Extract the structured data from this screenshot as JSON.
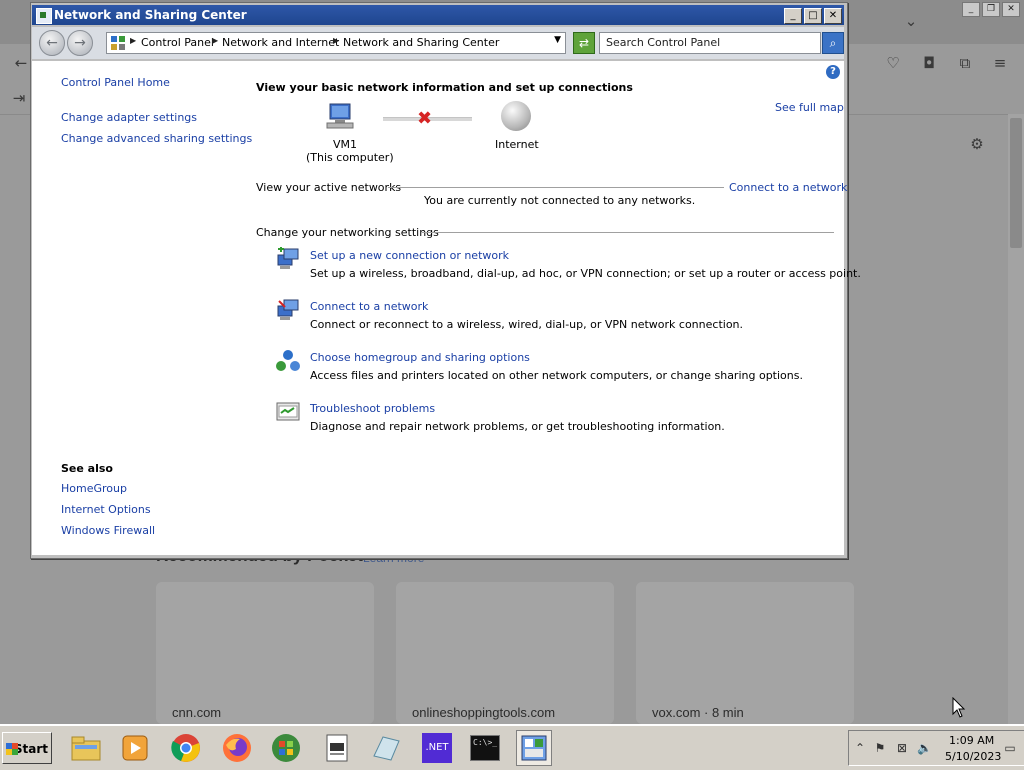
{
  "window": {
    "title": "Network and Sharing Center"
  },
  "address_bar": {
    "crumbs": [
      "Control Panel",
      "Network and Internet",
      "Network and Sharing Center"
    ],
    "search_placeholder": "Search Control Panel"
  },
  "sidebar": {
    "home": "Control Panel Home",
    "links": [
      "Change adapter settings",
      "Change advanced sharing settings"
    ],
    "see_also_heading": "See also",
    "see_also": [
      "HomeGroup",
      "Internet Options",
      "Windows Firewall"
    ]
  },
  "main": {
    "heading": "View your basic network information and set up connections",
    "see_full_map": "See full map",
    "computer_name": "VM1",
    "computer_sub": "(This computer)",
    "internet_label": "Internet",
    "active_networks_label": "View your active networks",
    "connect_link": "Connect to a network",
    "not_connected": "You are currently not connected to any networks.",
    "change_settings_label": "Change your networking settings",
    "tasks": [
      {
        "title": "Set up a new connection or network",
        "desc": "Set up a wireless, broadband, dial-up, ad hoc, or VPN connection; or set up a router or access point.",
        "icon": "new-connection-icon"
      },
      {
        "title": "Connect to a network",
        "desc": "Connect or reconnect to a wireless, wired, dial-up, or VPN network connection.",
        "icon": "connect-network-icon"
      },
      {
        "title": "Choose homegroup and sharing options",
        "desc": "Access files and printers located on other network computers, or change sharing options.",
        "icon": "homegroup-icon"
      },
      {
        "title": "Troubleshoot problems",
        "desc": "Diagnose and repair network problems, or get troubleshooting information.",
        "icon": "troubleshoot-icon"
      }
    ]
  },
  "background_browser": {
    "recommended": "Recommended by Pocket",
    "learn_more": "Learn more",
    "cards": [
      "cnn.com",
      "onlineshoppingtools.com",
      "vox.com · 8 min"
    ]
  },
  "taskbar": {
    "start_label": "Start",
    "net_label": ".NET",
    "cmd_label": "C:\\>_",
    "time": "1:09 AM",
    "date": "5/10/2023"
  },
  "colors": {
    "link": "#1a3fa5",
    "titlebar": "#2e57a8",
    "error_x": "#d62424"
  }
}
